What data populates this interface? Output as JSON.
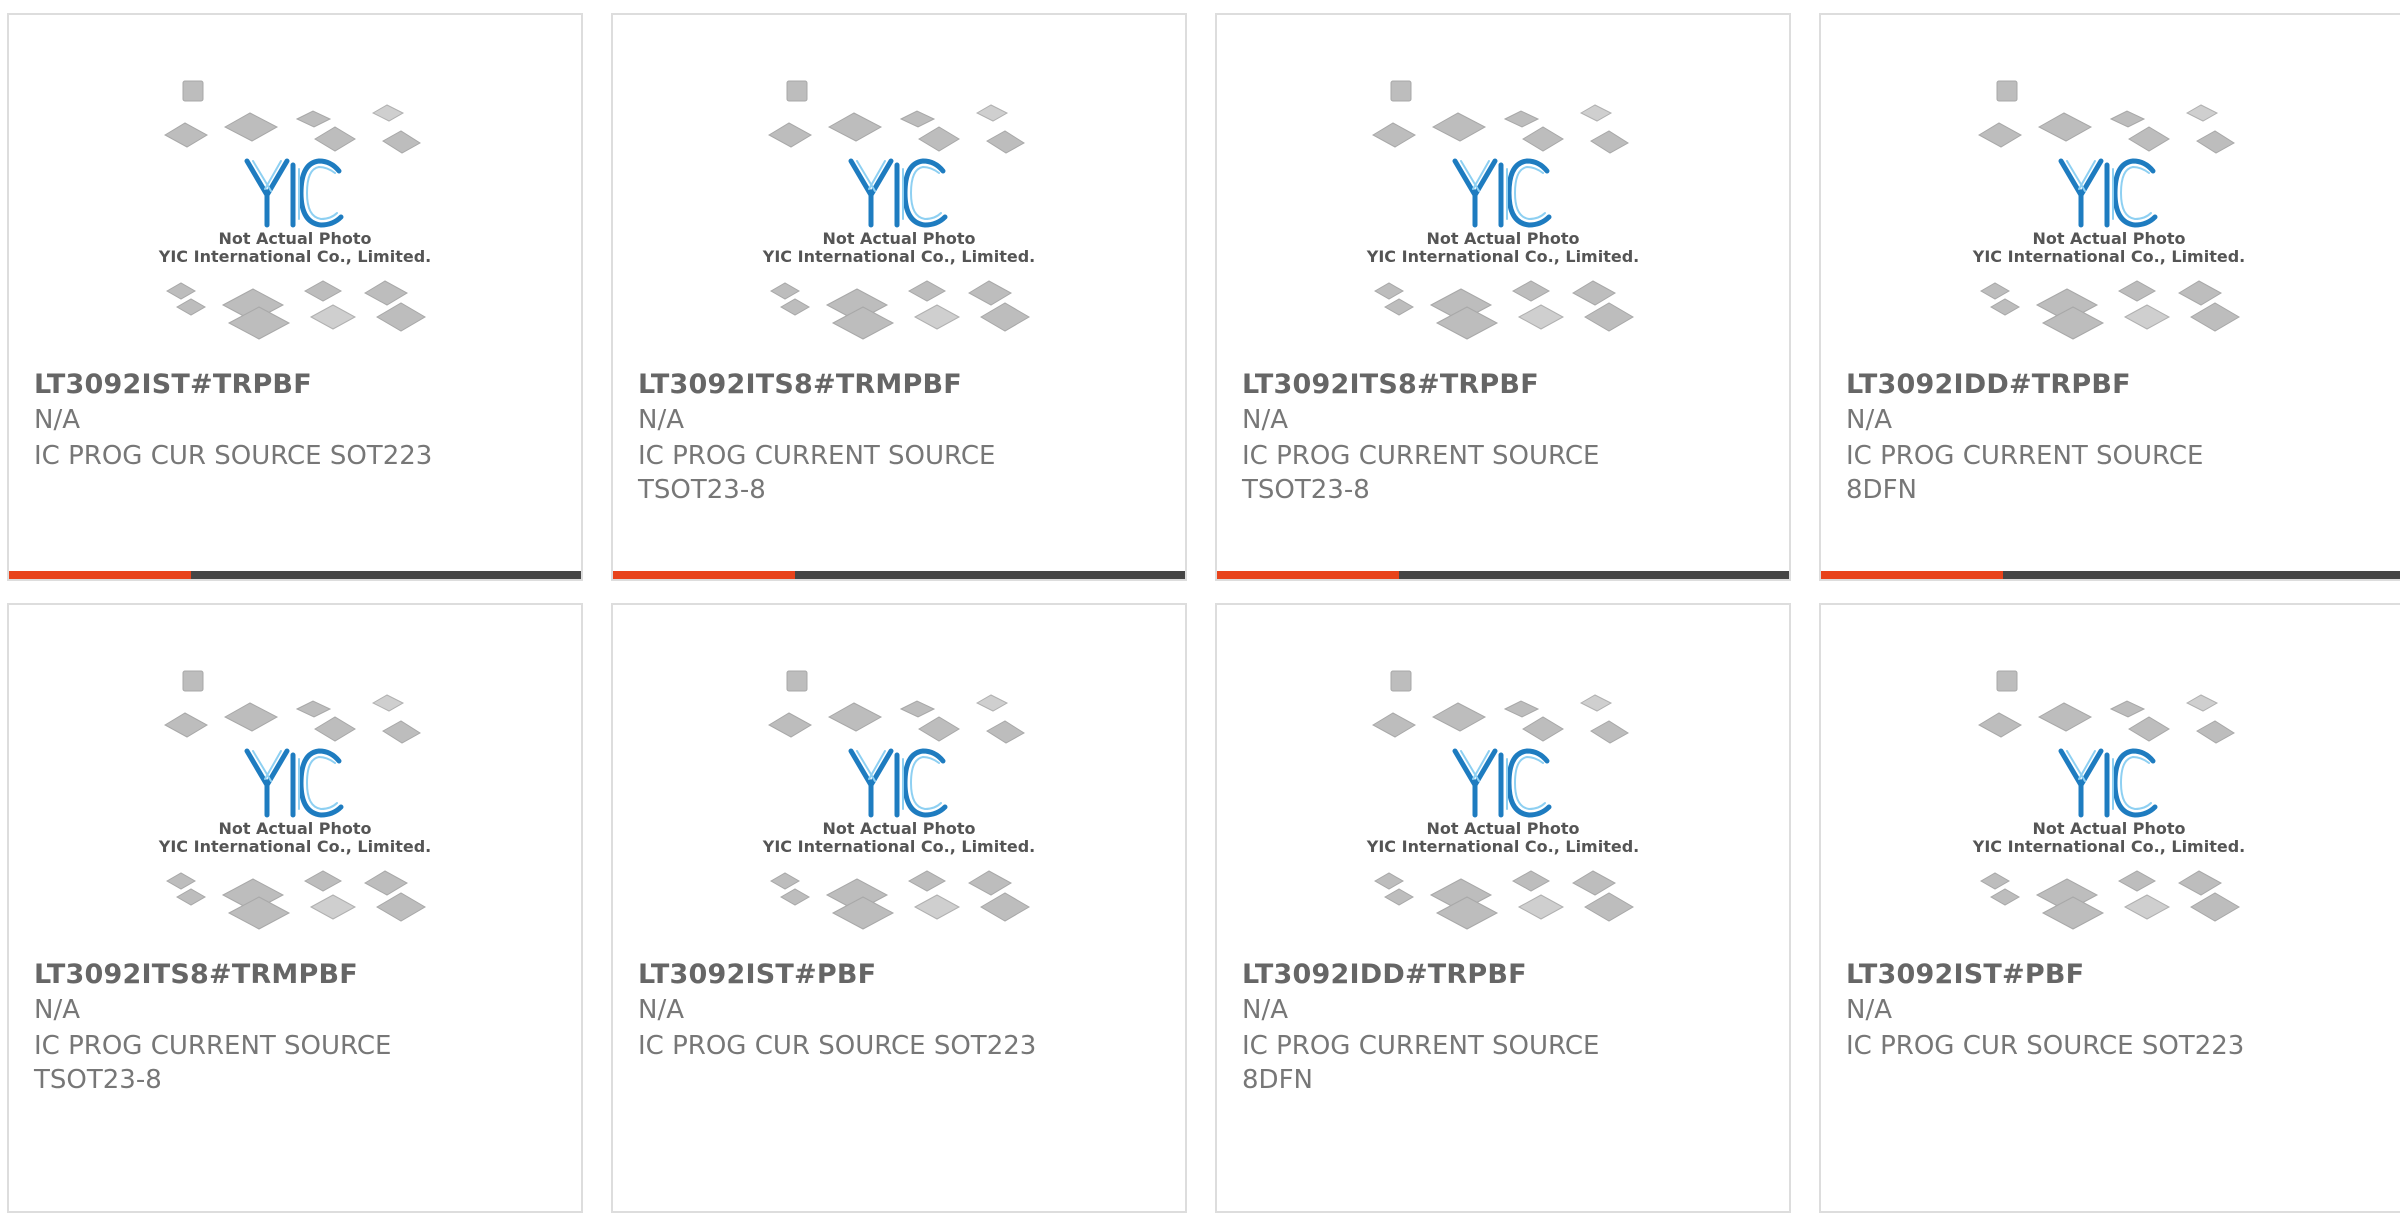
{
  "placeholder": {
    "line1": "Not Actual Photo",
    "line2": "YIC International Co., Limited.",
    "logo": "YIC"
  },
  "colors": {
    "accent": "#e8431b",
    "bar": "#454545",
    "logo": "#1e7cc0"
  },
  "products": [
    {
      "part": "LT3092IST#TRPBF",
      "manufacturer": "N/A",
      "description": "IC PROG CUR SOURCE SOT223"
    },
    {
      "part": "LT3092ITS8#TRMPBF",
      "manufacturer": "N/A",
      "description": "IC PROG CURRENT SOURCE TSOT23-8"
    },
    {
      "part": "LT3092ITS8#TRPBF",
      "manufacturer": "N/A",
      "description": "IC PROG CURRENT SOURCE TSOT23-8"
    },
    {
      "part": "LT3092IDD#TRPBF",
      "manufacturer": "N/A",
      "description": "IC PROG CURRENT SOURCE 8DFN"
    },
    {
      "part": "LT3092ITS8#TRMPBF",
      "manufacturer": "N/A",
      "description": "IC PROG CURRENT SOURCE TSOT23-8"
    },
    {
      "part": "LT3092IST#PBF",
      "manufacturer": "N/A",
      "description": "IC PROG CUR SOURCE SOT223"
    },
    {
      "part": "LT3092IDD#TRPBF",
      "manufacturer": "N/A",
      "description": "IC PROG CURRENT SOURCE 8DFN"
    },
    {
      "part": "LT3092IST#PBF",
      "manufacturer": "N/A",
      "description": "IC PROG CUR SOURCE SOT223"
    }
  ]
}
